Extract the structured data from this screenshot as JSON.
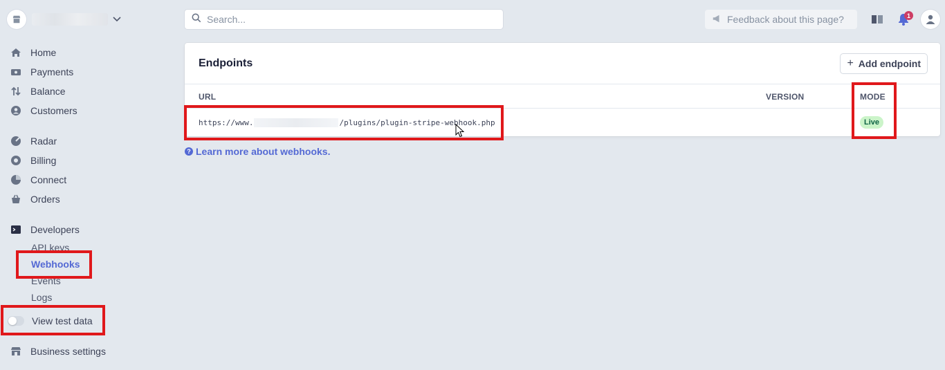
{
  "colors": {
    "accent": "#5469d4",
    "highlight": "#e0181b",
    "live_badge_bg": "#cbf4c9",
    "live_badge_text": "#0e6245",
    "notif": "#cd3d64"
  },
  "sidebar": {
    "items": [
      {
        "label": "Home",
        "icon": "home-icon"
      },
      {
        "label": "Payments",
        "icon": "payments-icon"
      },
      {
        "label": "Balance",
        "icon": "balance-icon"
      },
      {
        "label": "Customers",
        "icon": "customers-icon"
      },
      {
        "label": "Radar",
        "icon": "radar-icon"
      },
      {
        "label": "Billing",
        "icon": "billing-icon"
      },
      {
        "label": "Connect",
        "icon": "connect-icon"
      },
      {
        "label": "Orders",
        "icon": "orders-icon"
      },
      {
        "label": "Developers",
        "icon": "terminal-icon"
      }
    ],
    "developer_subitems": [
      "API keys",
      "Webhooks",
      "Events",
      "Logs"
    ],
    "active_subitem": "Webhooks",
    "test_data_toggle": "View test data",
    "business_settings": "Business settings"
  },
  "header": {
    "search_placeholder": "Search...",
    "feedback": "Feedback about this page?",
    "notification_count": "1"
  },
  "endpoints": {
    "title": "Endpoints",
    "add_button": "Add endpoint",
    "columns": [
      "URL",
      "VERSION",
      "MODE"
    ],
    "rows": [
      {
        "url_prefix": "https://www.",
        "url_suffix": "/plugins/plugin-stripe-webhook.php",
        "version": "",
        "mode": "Live"
      }
    ]
  },
  "learn_more": "Learn more about webhooks."
}
